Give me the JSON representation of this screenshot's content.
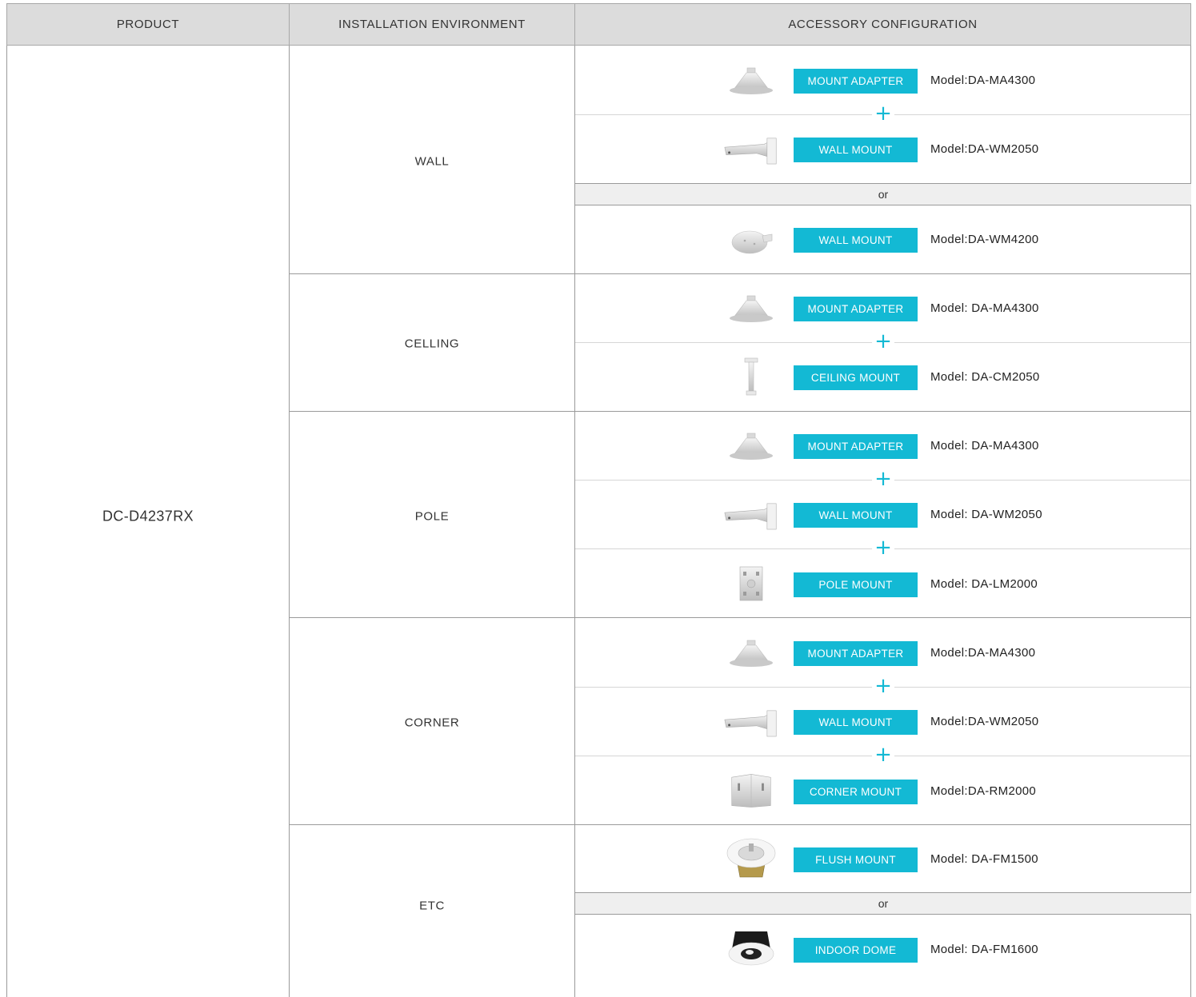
{
  "headers": {
    "product": "PRODUCT",
    "environment": "INSTALLATION ENVIRONMENT",
    "accessory": "ACCESSORY CONFIGURATION"
  },
  "product": "DC-D4237RX",
  "environments": {
    "wall": "WALL",
    "ceiling": "CELLING",
    "pole": "POLE",
    "corner": "CORNER",
    "etc": "ETC"
  },
  "separators": {
    "or": "or",
    "plus": "+"
  },
  "accessories": {
    "wall_1": {
      "label": "MOUNT ADAPTER",
      "model": "Model:DA-MA4300",
      "icon": "mount-adapter-icon"
    },
    "wall_2": {
      "label": "WALL MOUNT",
      "model": "Model:DA-WM2050",
      "icon": "wall-mount-arm-icon"
    },
    "wall_3": {
      "label": "WALL MOUNT",
      "model": "Model:DA-WM4200",
      "icon": "wall-mount-disc-icon"
    },
    "ceiling_1": {
      "label": "MOUNT ADAPTER",
      "model": "Model: DA-MA4300",
      "icon": "mount-adapter-icon"
    },
    "ceiling_2": {
      "label": "CEILING MOUNT",
      "model": "Model: DA-CM2050",
      "icon": "ceiling-pendant-icon"
    },
    "pole_1": {
      "label": "MOUNT ADAPTER",
      "model": "Model: DA-MA4300",
      "icon": "mount-adapter-icon"
    },
    "pole_2": {
      "label": "WALL MOUNT",
      "model": "Model: DA-WM2050",
      "icon": "wall-mount-arm-icon"
    },
    "pole_3": {
      "label": "POLE MOUNT",
      "model": "Model: DA-LM2000",
      "icon": "pole-mount-icon"
    },
    "corner_1": {
      "label": "MOUNT ADAPTER",
      "model": "Model:DA-MA4300",
      "icon": "mount-adapter-icon"
    },
    "corner_2": {
      "label": "WALL MOUNT",
      "model": "Model:DA-WM2050",
      "icon": "wall-mount-arm-icon"
    },
    "corner_3": {
      "label": "CORNER MOUNT",
      "model": "Model:DA-RM2000",
      "icon": "corner-mount-icon"
    },
    "etc_1": {
      "label": "FLUSH MOUNT",
      "model": "Model: DA-FM1500",
      "icon": "flush-mount-icon"
    },
    "etc_2": {
      "label": "INDOOR DOME",
      "model": "Model: DA-FM1600",
      "icon": "indoor-dome-flush-icon"
    }
  },
  "colors": {
    "accent": "#13b9d4",
    "header_bg": "#dcdcdc",
    "or_band_bg": "#efefef"
  }
}
